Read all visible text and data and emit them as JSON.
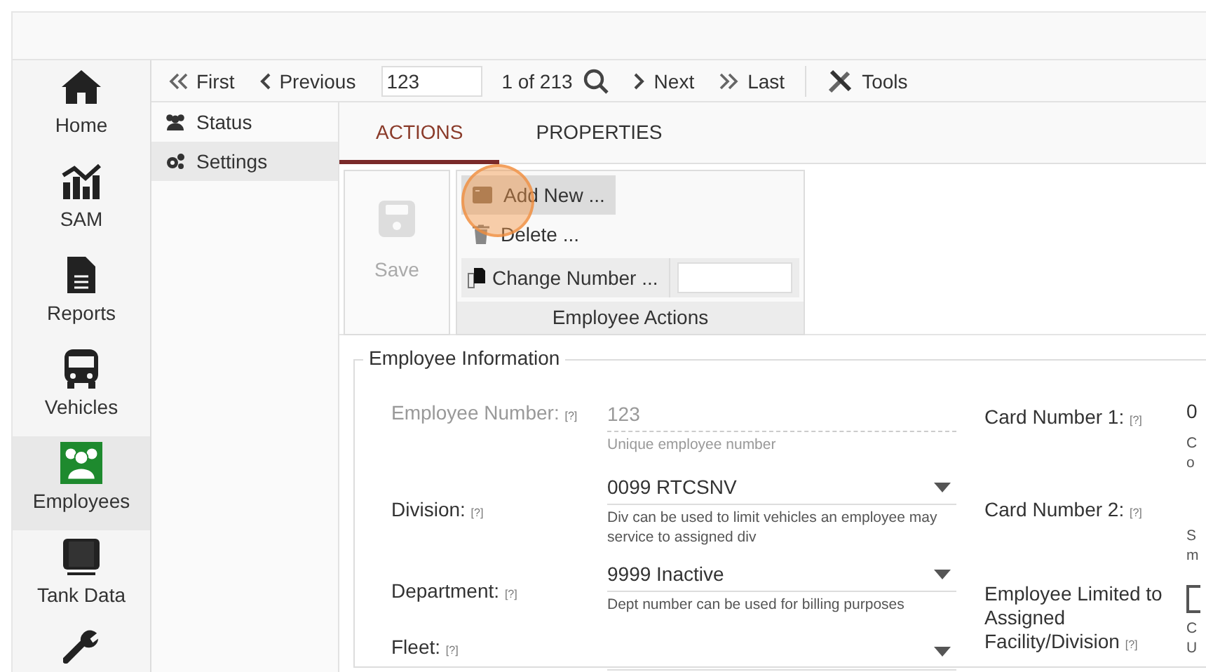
{
  "nav": [
    {
      "label": "Home",
      "selected": false
    },
    {
      "label": "SAM",
      "selected": false
    },
    {
      "label": "Reports",
      "selected": false
    },
    {
      "label": "Vehicles",
      "selected": false
    },
    {
      "label": "Employees",
      "selected": true
    },
    {
      "label": "Tank Data",
      "selected": false
    },
    {
      "selected": false
    }
  ],
  "toolbar": {
    "first": "First",
    "previous": "Previous",
    "record": "123",
    "count": "1 of 213",
    "next": "Next",
    "last": "Last",
    "tools": "Tools"
  },
  "submenu": [
    {
      "label": "Status",
      "selected": false
    },
    {
      "label": "Settings",
      "selected": true
    }
  ],
  "tabs": [
    {
      "label": "ACTIONS",
      "selected": true
    },
    {
      "label": "PROPERTIES",
      "selected": false
    }
  ],
  "actions": {
    "save": {
      "label": "Save",
      "disabled": true
    },
    "add_new": "Add New ...",
    "delete": "Delete ...",
    "change_number": "Change Number ...",
    "group_label": "Employee Actions"
  },
  "section_title": "Employee Information",
  "left_fields": [
    {
      "kind": "text",
      "label": "Employee Number:",
      "help": "[?]",
      "value": "123",
      "disabled": true,
      "hint": "Unique employee number"
    },
    {
      "kind": "select",
      "label": "Division:",
      "help": "[?]",
      "value": "0099 RTCSNV",
      "hint": "Div can be used to limit vehicles an employee may service to assigned div"
    },
    {
      "kind": "select",
      "label": "Department:",
      "help": "[?]",
      "value": "9999 Inactive",
      "hint": "Dept number can be used for billing purposes"
    },
    {
      "kind": "select",
      "label": "Fleet:",
      "help": "[?]"
    }
  ],
  "right_fields": [
    {
      "kind": "text",
      "label": "Card Number 1:",
      "help": "[?]",
      "value": "0",
      "hint": [
        "C",
        "o"
      ]
    },
    {
      "kind": "text",
      "label": "Card Number 2:",
      "help": "[?]",
      "hint": [
        "S",
        "m"
      ]
    },
    {
      "kind": "checkbox",
      "label": "Employee Limited to Assigned Facility/Division",
      "help": "[?]",
      "checked": false,
      "hint": [
        "C",
        "U"
      ]
    }
  ]
}
